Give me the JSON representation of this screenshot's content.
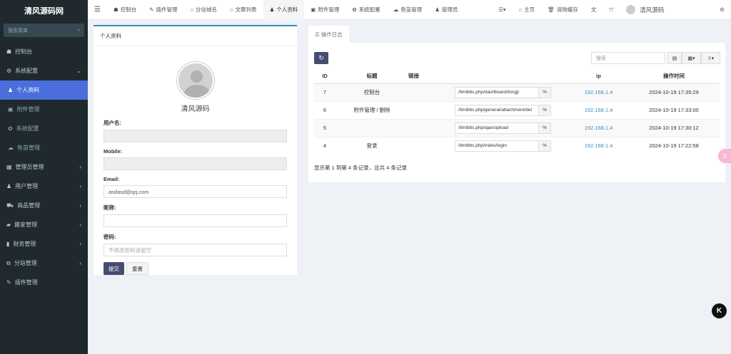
{
  "sidebar": {
    "logo": "清风源码网",
    "search_placeholder": "搜索菜单",
    "items": [
      {
        "label": "控制台",
        "icon": "dashboard-icon"
      },
      {
        "label": "系统配置",
        "icon": "cogs-icon",
        "expanded": true
      },
      {
        "label": "个人资料",
        "icon": "user-icon",
        "active": true,
        "sub": true
      },
      {
        "label": "附件管理",
        "icon": "file-image-icon",
        "sub": true
      },
      {
        "label": "系统配置",
        "icon": "gear-icon",
        "sub": true
      },
      {
        "label": "鱼苗管理",
        "icon": "cloud-icon",
        "sub": true
      },
      {
        "label": "管理员管理",
        "icon": "list-icon",
        "chevron": true
      },
      {
        "label": "用户管理",
        "icon": "user-icon",
        "chevron": true
      },
      {
        "label": "商品管理",
        "icon": "cart-icon",
        "chevron": true
      },
      {
        "label": "搬家管理",
        "icon": "truck-icon",
        "chevron": true
      },
      {
        "label": "财务管理",
        "icon": "bookmark-icon",
        "chevron": true
      },
      {
        "label": "分站管理",
        "icon": "clone-icon",
        "chevron": true
      },
      {
        "label": "插件管理",
        "icon": "plug-icon"
      }
    ]
  },
  "topnav": {
    "tabs": [
      {
        "label": "控制台",
        "icon": "dashboard-icon"
      },
      {
        "label": "插件管理",
        "icon": "plug-icon"
      },
      {
        "label": "分站域名",
        "icon": "circle-icon"
      },
      {
        "label": "文章列表",
        "icon": "circle-icon"
      },
      {
        "label": "个人资料",
        "icon": "user-icon",
        "active": true
      },
      {
        "label": "附件管理",
        "icon": "file-image-icon"
      },
      {
        "label": "系统配置",
        "icon": "gear-icon"
      },
      {
        "label": "鱼苗管理",
        "icon": "cloud-icon"
      },
      {
        "label": "管理员",
        "icon": "user-icon"
      }
    ],
    "home": "主页",
    "clear_cache": "清除缓存",
    "username": "清风源码"
  },
  "profile": {
    "title": "个人资料",
    "name": "清风源码",
    "username_label": "用户名:",
    "username_value": "",
    "mobile_label": "Mobile:",
    "mobile_value": "",
    "email_label": "Email:",
    "email_value": "asdasd@qq.com",
    "nickname_label": "昵称:",
    "nickname_value": "",
    "password_label": "密码:",
    "password_placeholder": "不修改密码请留空",
    "submit": "提交",
    "reset": "重置"
  },
  "log": {
    "tab": "操作日志",
    "search_placeholder": "搜索",
    "columns": [
      "ID",
      "标题",
      "链接",
      "ip",
      "操作时间"
    ],
    "rows": [
      {
        "id": "7",
        "title": "控制台",
        "url": "/timibbs.php/dashboard/tongji",
        "ip": "192.168.1.4",
        "time": "2024-10-19 17:35:29"
      },
      {
        "id": "6",
        "title": "附件管理 / 删除",
        "url": "/timibbs.php/general/attachment/del",
        "ip": "192.168.1.4",
        "time": "2024-10-19 17:33:00"
      },
      {
        "id": "5",
        "title": "",
        "url": "/timibbs.php/ajax/upload",
        "ip": "192.168.1.4",
        "time": "2024-10-19 17:30:12"
      },
      {
        "id": "4",
        "title": "登录",
        "url": "/timibbs.php/index/login",
        "ip": "192.168.1.4",
        "time": "2024-10-19 17:22:58"
      }
    ],
    "footer": "显示第 1 到第 4 条记录，总共 4 条记录"
  },
  "colors": {
    "sidebar_bg": "#1f292e",
    "active": "#4a6fdc",
    "primary_btn": "#444c70",
    "link": "#3c8dbc"
  }
}
